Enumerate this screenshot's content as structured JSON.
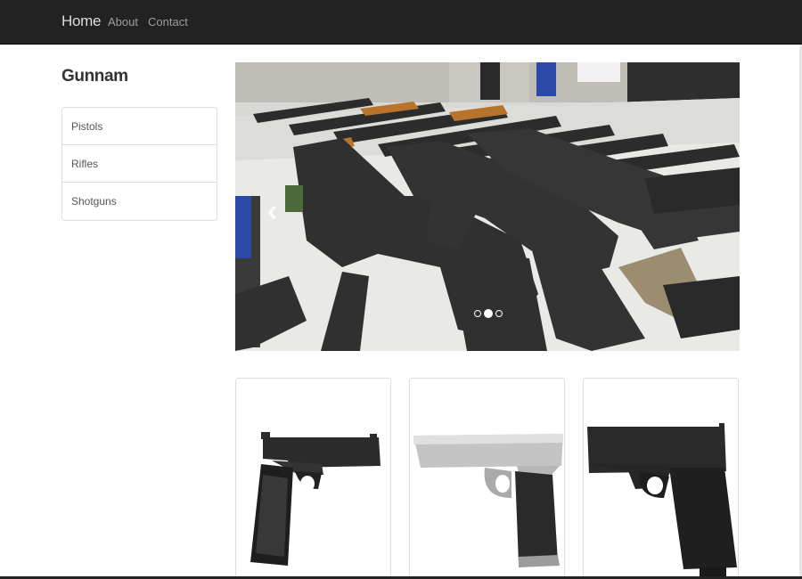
{
  "navbar": {
    "brand": "Home",
    "links": [
      {
        "label": "About"
      },
      {
        "label": "Contact"
      }
    ]
  },
  "sidebar": {
    "title": "Gunnam",
    "categories": [
      {
        "label": "Pistols"
      },
      {
        "label": "Rifles"
      },
      {
        "label": "Shotguns"
      }
    ]
  },
  "carousel": {
    "slide_count": 3,
    "active_index": 1,
    "prev_glyph": "‹"
  },
  "products": [
    {
      "icon": "black-1911-pistol-image"
    },
    {
      "icon": "silver-desert-eagle-pistol-image"
    },
    {
      "icon": "black-glock-pistol-image"
    }
  ]
}
